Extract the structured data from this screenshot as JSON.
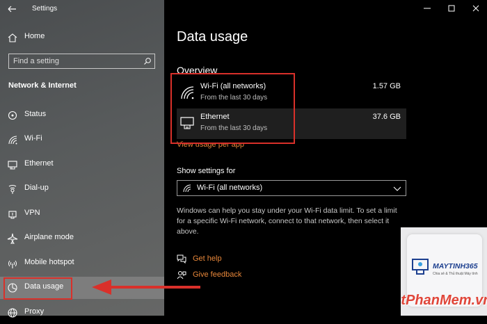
{
  "window": {
    "title": "Settings"
  },
  "sidebar": {
    "home_label": "Home",
    "search_placeholder": "Find a setting",
    "section_title": "Network & Internet",
    "items": [
      {
        "label": "Status",
        "icon": "status-icon"
      },
      {
        "label": "Wi-Fi",
        "icon": "wifi-icon"
      },
      {
        "label": "Ethernet",
        "icon": "ethernet-icon"
      },
      {
        "label": "Dial-up",
        "icon": "dialup-icon"
      },
      {
        "label": "VPN",
        "icon": "vpn-icon"
      },
      {
        "label": "Airplane mode",
        "icon": "airplane-icon"
      },
      {
        "label": "Mobile hotspot",
        "icon": "hotspot-icon"
      },
      {
        "label": "Data usage",
        "icon": "data-usage-icon",
        "selected": true
      },
      {
        "label": "Proxy",
        "icon": "globe-icon"
      }
    ]
  },
  "main": {
    "title": "Data usage",
    "overview_heading": "Overview",
    "networks": [
      {
        "name": "Wi-Fi (all networks)",
        "sub": "From the last 30 days",
        "value": "1.57 GB",
        "icon": "wifi-icon"
      },
      {
        "name": "Ethernet",
        "sub": "From the last 30 days",
        "value": "37.6 GB",
        "icon": "ethernet-icon"
      }
    ],
    "view_usage_link": "View usage per app",
    "show_settings_label": "Show settings for",
    "dropdown_value": "Wi-Fi (all networks)",
    "description": "Windows can help you stay under your Wi-Fi data limit. To set a limit for a specific Wi-Fi network, connect to that network, then select it above.",
    "help_links": [
      {
        "label": "Get help",
        "icon": "help-icon"
      },
      {
        "label": "Give feedback",
        "icon": "feedback-icon"
      }
    ]
  },
  "watermark": {
    "brand": "MAYTINH365",
    "tagline": "Chia sẻ & Thủ thuật Máy tính",
    "site": "ThuThuatPhanMem.vn"
  },
  "colors": {
    "accent": "#e8873a",
    "highlight": "#d9302a",
    "selected_bg": "#7d7d7d"
  }
}
